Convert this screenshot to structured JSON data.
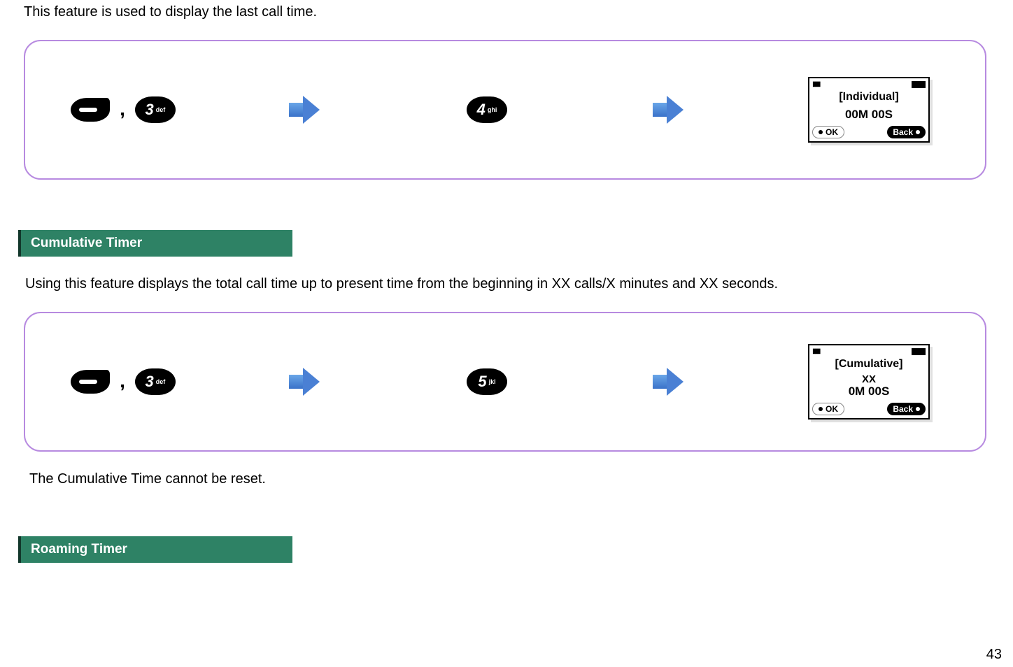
{
  "intro_text": "This feature is used to display the last call time.",
  "box1": {
    "key1_digit": "3",
    "key1_sub": "def",
    "comma": ",",
    "key2_digit": "4",
    "key2_sub": "ghi",
    "screen": {
      "title": "[Individual]",
      "value": "00M 00S",
      "ok": "OK",
      "back": "Back"
    }
  },
  "section1_title": "Cumulative Timer",
  "section1_body": "Using this feature displays the total call time up to present time from the beginning in XX calls/X minutes and XX seconds.",
  "box2": {
    "key1_digit": "3",
    "key1_sub": "def",
    "comma": ",",
    "key2_digit": "5",
    "key2_sub": "jkl",
    "screen": {
      "title": "[Cumulative]",
      "xx": "XX",
      "value": "0M 00S",
      "ok": "OK",
      "back": "Back"
    }
  },
  "note": "The Cumulative Time  cannot be reset.",
  "section2_title": "Roaming Timer",
  "page_number": "43"
}
